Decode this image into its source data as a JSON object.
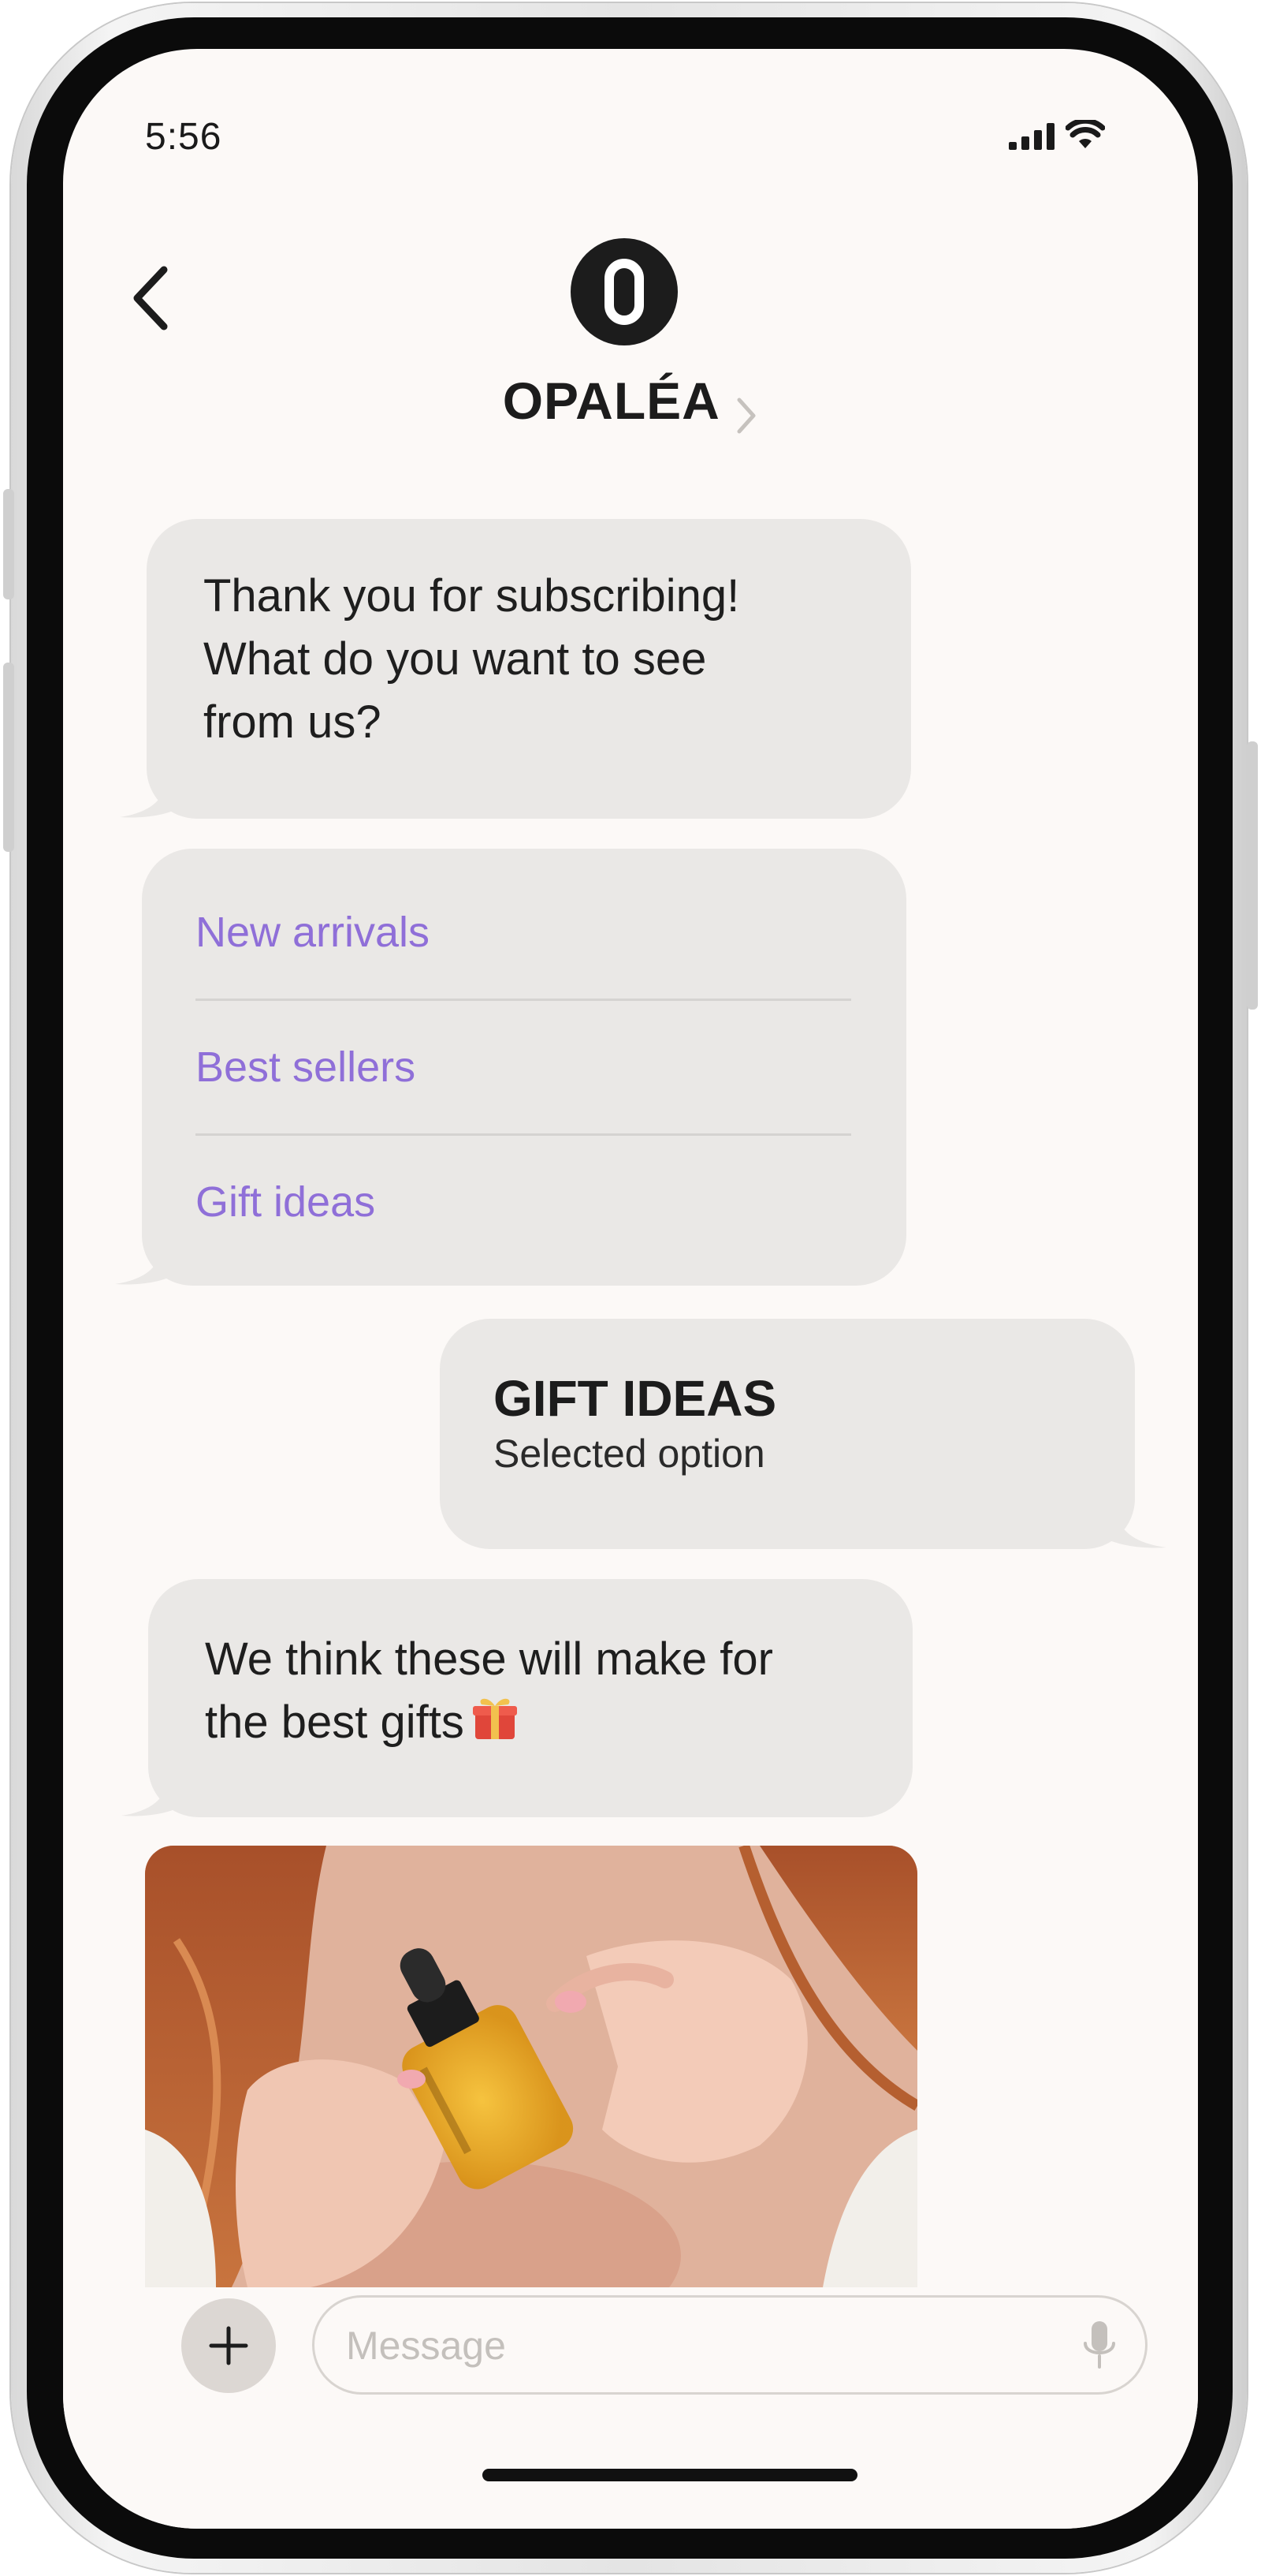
{
  "status_bar": {
    "time": "5:56"
  },
  "header": {
    "contact_name": "OPALÉA"
  },
  "messages": {
    "welcome": [
      "Thank you for subscribing!",
      "What do you want to see",
      "from us?"
    ],
    "options": [
      "New arrivals",
      "Best sellers",
      "Gift ideas"
    ],
    "reply": {
      "title": "GIFT IDEAS",
      "subtitle": "Selected option"
    },
    "followup": [
      "We think these will make for",
      "the best gifts"
    ]
  },
  "composer": {
    "placeholder": "Message"
  },
  "colors": {
    "screen_bg": "#fcf9f7",
    "bubble": "#eae8e6",
    "option_link": "#8f6fd8"
  }
}
